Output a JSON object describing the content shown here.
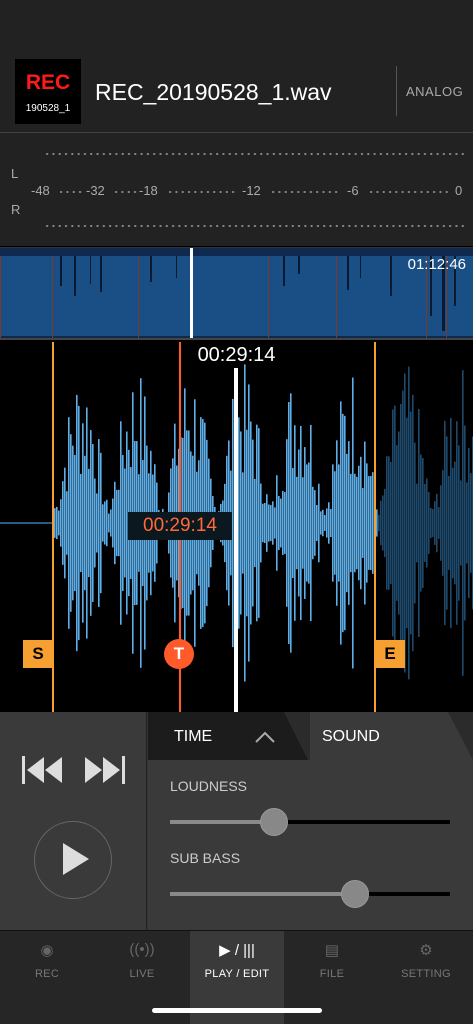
{
  "header": {
    "rec_badge_title": "REC",
    "rec_badge_sub": "190528_1",
    "filename": "REC_20190528_1.wav",
    "input_mode": "ANALOG"
  },
  "meter": {
    "left_label": "L",
    "right_label": "R",
    "scale": [
      "-48",
      "-32",
      "-18",
      "-12",
      "-6",
      "0"
    ]
  },
  "overview": {
    "total_time": "01:12:46",
    "playhead_position": 0.4
  },
  "waveform": {
    "current_time": "00:29:14",
    "marker_start_label": "S",
    "marker_end_label": "E",
    "marker_trim_label": "T",
    "trim_time": "00:29:14"
  },
  "tabs": {
    "time_label": "TIME",
    "sound_label": "SOUND",
    "active": "SOUND"
  },
  "sound": {
    "loudness_label": "LOUDNESS",
    "loudness_value": 0.37,
    "subbass_label": "SUB BASS",
    "subbass_value": 0.66
  },
  "nav": {
    "items": [
      {
        "label": "REC",
        "icon": "record-icon"
      },
      {
        "label": "LIVE",
        "icon": "broadcast-icon"
      },
      {
        "label": "PLAY / EDIT",
        "icon": "play-edit-icon"
      },
      {
        "label": "FILE",
        "icon": "file-icon"
      },
      {
        "label": "SETTING",
        "icon": "gear-icon"
      }
    ],
    "active": "PLAY / EDIT"
  },
  "colors": {
    "accent_orange": "#f5a030",
    "trim_red": "#ff5a2a",
    "wave_blue": "#5eaee8",
    "rec_red": "#ff1a1a"
  }
}
